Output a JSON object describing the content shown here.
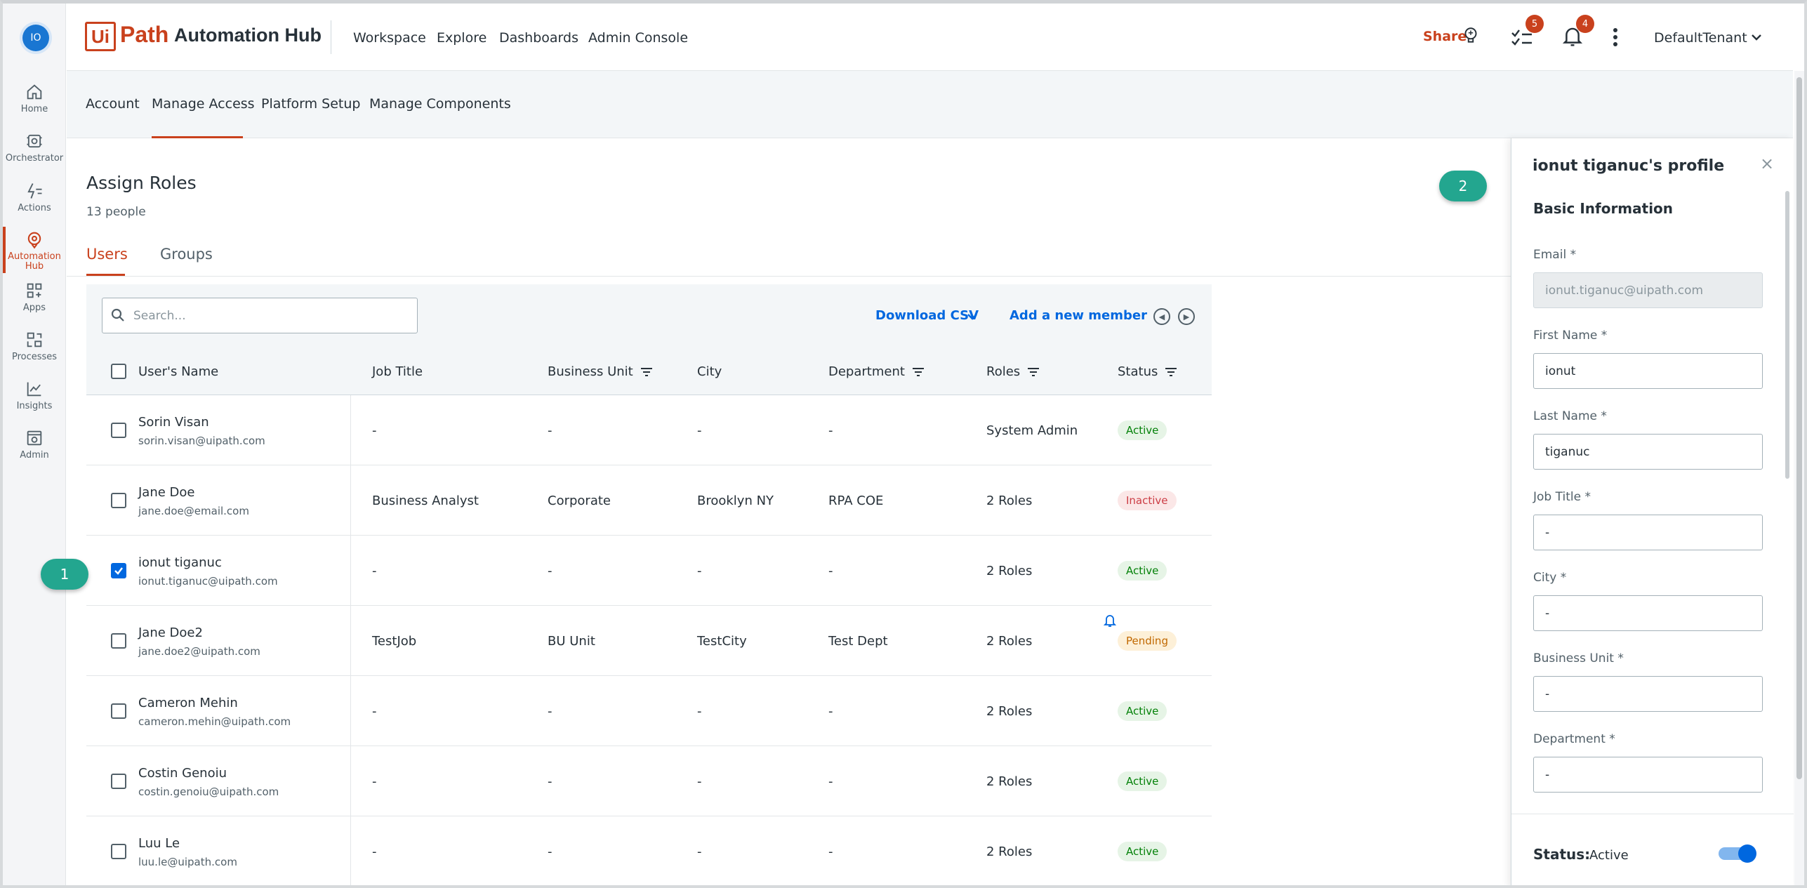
{
  "rail": {
    "avatar": "IO",
    "items": [
      {
        "label": "Home",
        "icon": "home-icon"
      },
      {
        "label": "Orchestrator",
        "icon": "orchestrator-icon"
      },
      {
        "label": "Actions",
        "icon": "actions-icon"
      },
      {
        "label": "Automation Hub",
        "icon": "automation-hub-icon",
        "active": true
      },
      {
        "label": "Apps",
        "icon": "apps-icon"
      },
      {
        "label": "Processes",
        "icon": "processes-icon"
      },
      {
        "label": "Insights",
        "icon": "insights-icon"
      },
      {
        "label": "Admin",
        "icon": "admin-icon"
      }
    ]
  },
  "header": {
    "logo_mark": "Ui",
    "logo_path": "Path",
    "product": "Automation Hub",
    "nav": [
      "Workspace",
      "Explore",
      "Dashboards",
      "Admin Console"
    ],
    "share": "Share",
    "tasks_badge": "5",
    "notifications_badge": "4",
    "tenant": "DefaultTenant"
  },
  "subnav": [
    "Account",
    "Manage Access",
    "Platform Setup",
    "Manage Components"
  ],
  "page": {
    "title": "Assign Roles",
    "count": "13 people",
    "tabs": [
      "Users",
      "Groups"
    ]
  },
  "toolbar": {
    "search_placeholder": "Search...",
    "download_csv": "Download CSV",
    "add_member": "Add a new member"
  },
  "columns": [
    "User's Name",
    "Job Title",
    "Business Unit",
    "City",
    "Department",
    "Roles",
    "Status"
  ],
  "rows": [
    {
      "name": "Sorin Visan",
      "email": "sorin.visan@uipath.com",
      "job": "-",
      "bu": "-",
      "city": "-",
      "dept": "-",
      "roles": "System Admin",
      "status": "Active",
      "checked": false
    },
    {
      "name": "Jane Doe",
      "email": "jane.doe@email.com",
      "job": "Business Analyst",
      "bu": "Corporate",
      "city": "Brooklyn NY",
      "dept": "RPA COE",
      "roles": "2 Roles",
      "status": "Inactive",
      "checked": false
    },
    {
      "name": "ionut tiganuc",
      "email": "ionut.tiganuc@uipath.com",
      "job": "-",
      "bu": "-",
      "city": "-",
      "dept": "-",
      "roles": "2 Roles",
      "status": "Active",
      "checked": true
    },
    {
      "name": "Jane Doe2",
      "email": "jane.doe2@uipath.com",
      "job": "TestJob",
      "bu": "BU Unit",
      "city": "TestCity",
      "dept": "Test Dept",
      "roles": "2 Roles",
      "status": "Pending",
      "checked": false
    },
    {
      "name": "Cameron Mehin",
      "email": "cameron.mehin@uipath.com",
      "job": "-",
      "bu": "-",
      "city": "-",
      "dept": "-",
      "roles": "2 Roles",
      "status": "Active",
      "checked": false
    },
    {
      "name": "Costin Genoiu",
      "email": "costin.genoiu@uipath.com",
      "job": "-",
      "bu": "-",
      "city": "-",
      "dept": "-",
      "roles": "2 Roles",
      "status": "Active",
      "checked": false
    },
    {
      "name": "Luu Le",
      "email": "luu.le@uipath.com",
      "job": "-",
      "bu": "-",
      "city": "-",
      "dept": "-",
      "roles": "2 Roles",
      "status": "Active",
      "checked": false
    }
  ],
  "callouts": [
    "1",
    "2"
  ],
  "panel": {
    "title": "ionut tiganuc's profile",
    "close": "×",
    "section": "Basic Information",
    "fields": [
      {
        "label": "Email",
        "value": "ionut.tiganuc@uipath.com",
        "disabled": true
      },
      {
        "label": "First Name",
        "value": "ionut"
      },
      {
        "label": "Last Name",
        "value": "tiganuc"
      },
      {
        "label": "Job Title",
        "value": "-"
      },
      {
        "label": "City",
        "value": "-"
      },
      {
        "label": "Business Unit",
        "value": "-"
      },
      {
        "label": "Department",
        "value": "-"
      }
    ],
    "status_label": "Status:",
    "status_value": "Active"
  },
  "colors": {
    "accent": "#c9411d",
    "link": "#0067df",
    "callout": "#23a68f"
  }
}
